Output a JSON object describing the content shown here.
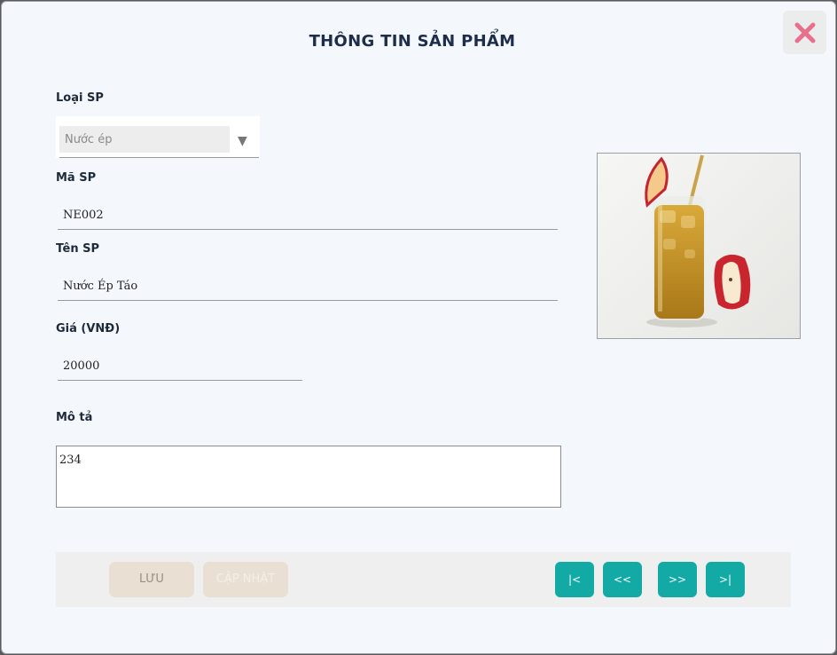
{
  "window": {
    "title": "THÔNG TIN SẢN PHẨM",
    "close_icon": "close-x-icon"
  },
  "form": {
    "category": {
      "label": "Loại SP",
      "value": "Nước ép",
      "arrow": "▼"
    },
    "code": {
      "label": "Mã SP",
      "value": "NE002"
    },
    "name": {
      "label": "Tên SP",
      "value": "Nước Ép Táo"
    },
    "price": {
      "label": "Giá (VNĐ)",
      "value": "20000"
    },
    "description": {
      "label": "Mô tả",
      "value": "234"
    }
  },
  "image": {
    "subject": "apple-juice-glass-with-apple-slices"
  },
  "actions": {
    "save_label": "LƯU",
    "update_label": "CẬP NHẬT",
    "first_label": "|<",
    "prev_label": "<<",
    "next_label": ">>",
    "last_label": ">|"
  },
  "colors": {
    "accent": "#13aaa6",
    "close_icon": "#e9708c",
    "title": "#1f2d4d",
    "disabled_button": "#e9dfd2"
  }
}
